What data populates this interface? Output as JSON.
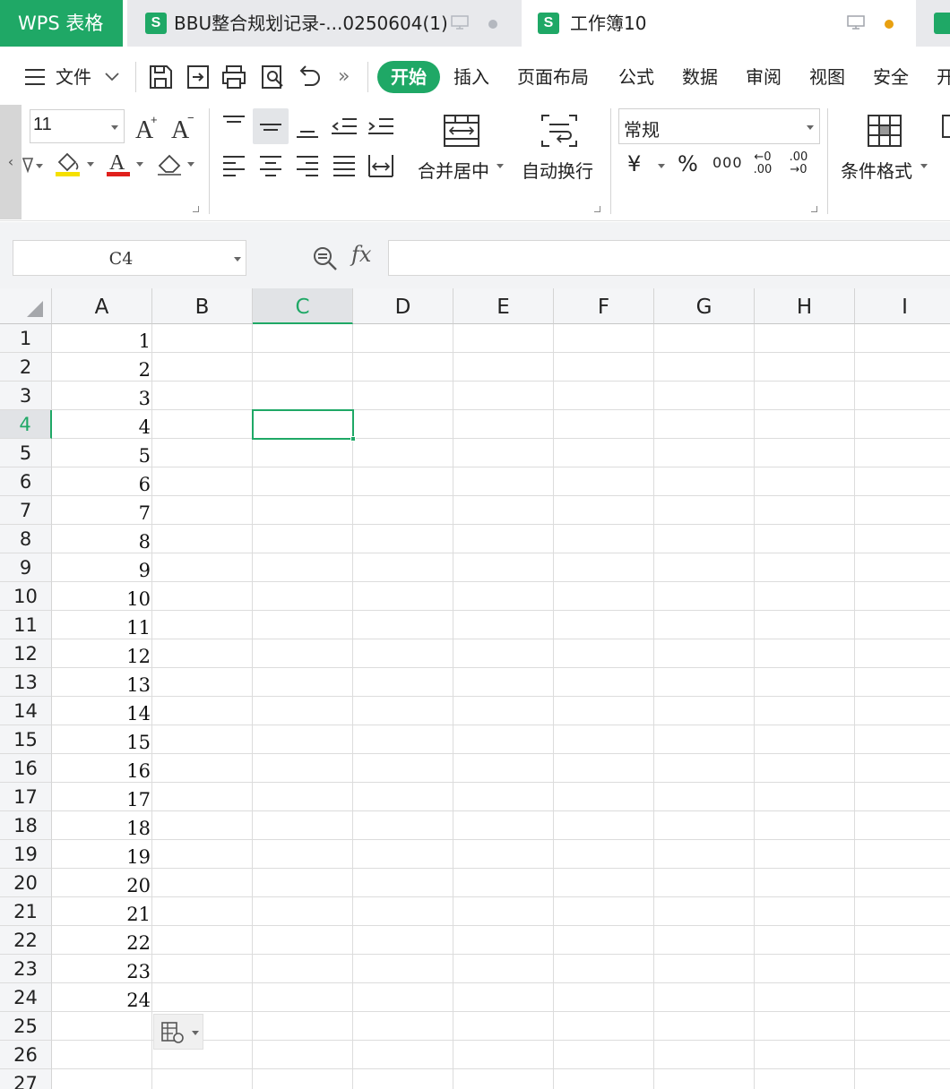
{
  "app": {
    "title": "WPS 表格"
  },
  "tabs": [
    {
      "icon": "S",
      "label": "BBU整合规划记录-...0250604(1)",
      "active": false,
      "status_dot_color": "#b4b8bf"
    },
    {
      "icon": "S",
      "label": "工作簿10",
      "active": true,
      "status_dot_color": "#e8a010"
    }
  ],
  "menu": {
    "file_label": "文件",
    "more_glyph": "»",
    "tabs": [
      "开始",
      "插入",
      "页面布局",
      "公式",
      "数据",
      "审阅",
      "视图",
      "安全",
      "开"
    ]
  },
  "ribbon": {
    "scroll_left_glyph": "‹",
    "font_size": "11",
    "merge_center_label": "合并居中",
    "wrap_text_label": "自动换行",
    "number_format": "常规",
    "currency_glyph": "¥",
    "percent_glyph": "%",
    "thousands_glyph": "000",
    "inc_decimal_glyph": "←0 .00",
    "dec_decimal_glyph": ".00 →0",
    "conditional_format_label": "条件格式"
  },
  "formula_bar": {
    "name_box": "C4",
    "fx_label": "fx",
    "formula": ""
  },
  "sheet": {
    "columns": [
      "A",
      "B",
      "C",
      "D",
      "E",
      "F",
      "G",
      "H",
      "I"
    ],
    "active_column": "C",
    "rows": [
      "1",
      "2",
      "3",
      "4",
      "5",
      "6",
      "7",
      "8",
      "9",
      "10",
      "11",
      "12",
      "13",
      "14",
      "15",
      "16",
      "17",
      "18",
      "19",
      "20",
      "21",
      "22",
      "23",
      "24",
      "25",
      "26",
      "27"
    ],
    "active_row": "4",
    "column_a_values": [
      "1",
      "2",
      "3",
      "4",
      "5",
      "6",
      "7",
      "8",
      "9",
      "10",
      "11",
      "12",
      "13",
      "14",
      "15",
      "16",
      "17",
      "18",
      "19",
      "20",
      "21",
      "22",
      "23",
      "24"
    ],
    "active_cell": "C4"
  },
  "colors": {
    "accent": "#1fa866",
    "status_orange": "#e8a010",
    "font_color_red": "#e0201c",
    "highlight_yellow": "#f5e000"
  }
}
